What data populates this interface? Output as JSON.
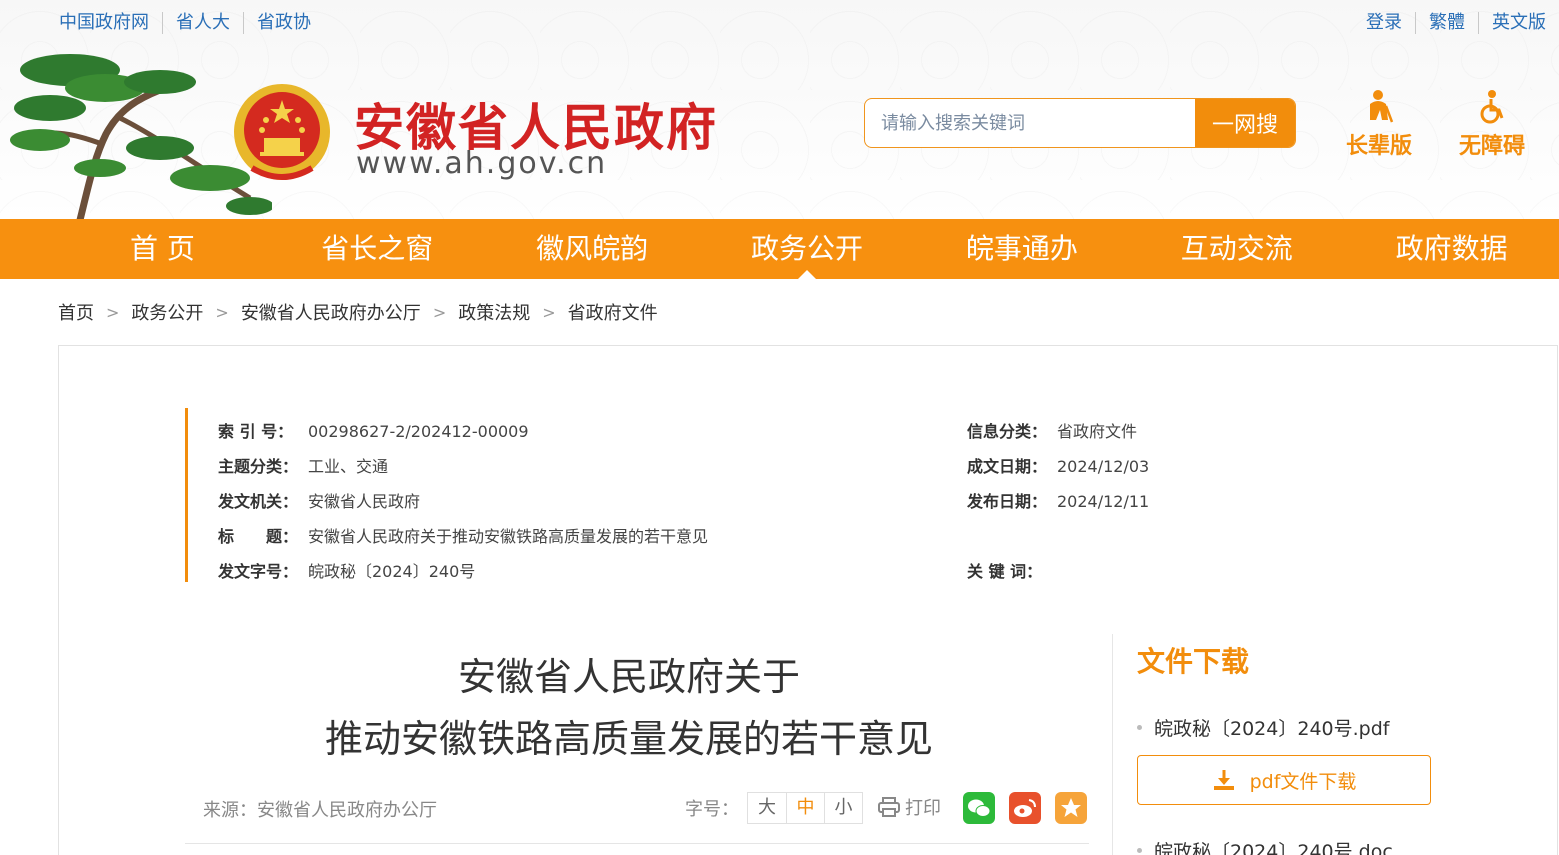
{
  "top_left_links": [
    "中国政府网",
    "省人大",
    "省政协"
  ],
  "top_right_links": [
    "登录",
    "繁體",
    "英文版"
  ],
  "site": {
    "title": "安徽省人民政府",
    "url": "www.ah.gov.cn"
  },
  "search": {
    "placeholder": "请输入搜索关键词",
    "button": "一网搜"
  },
  "access": {
    "elder": "长辈版",
    "barrier": "无障碍"
  },
  "nav": [
    "首 页",
    "省长之窗",
    "徽风皖韵",
    "政务公开",
    "皖事通办",
    "互动交流",
    "政府数据"
  ],
  "nav_active": "政务公开",
  "breadcrumb": [
    "首页",
    "政务公开",
    "安徽省人民政府办公厅",
    "政策法规",
    "省政府文件"
  ],
  "meta": {
    "index_no": {
      "key": "索 引 号：",
      "value": "00298627-2/202412-00009"
    },
    "topic": {
      "key": "主题分类：",
      "value": "工业、交通"
    },
    "issuer": {
      "key": "发文机关：",
      "value": "安徽省人民政府"
    },
    "title": {
      "key": "标　　题：",
      "value": "安徽省人民政府关于推动安徽铁路高质量发展的若干意见"
    },
    "doc_no": {
      "key": "发文字号：",
      "value": "皖政秘〔2024〕240号"
    },
    "category": {
      "key": "信息分类：",
      "value": "省政府文件"
    },
    "written_date": {
      "key": "成文日期：",
      "value": "2024/12/03"
    },
    "publish_date": {
      "key": "发布日期：",
      "value": "2024/12/11"
    },
    "keywords": {
      "key": "关 键 词：",
      "value": ""
    }
  },
  "document": {
    "title_line1": "安徽省人民政府关于",
    "title_line2": "推动安徽铁路高质量发展的若干意见",
    "source": "来源：安徽省人民政府办公厅",
    "font_label": "字号：",
    "font_sizes": [
      "大",
      "中",
      "小"
    ],
    "print": "打印"
  },
  "download": {
    "heading": "文件下载",
    "pdf_file": "皖政秘〔2024〕240号.pdf",
    "pdf_button": "pdf文件下载",
    "doc_file": "皖政秘〔2024〕240号.doc"
  },
  "colors": {
    "accent": "#f28d0c",
    "nav_bg": "#f7900f",
    "title_red": "#d22323",
    "link_blue": "#2a6fb7"
  }
}
